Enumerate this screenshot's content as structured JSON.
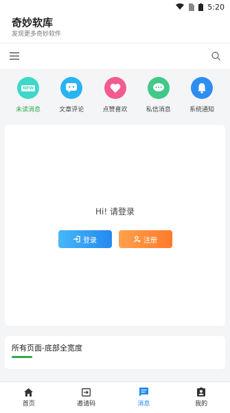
{
  "status": {
    "time": "5:20"
  },
  "app": {
    "title": "奇妙软库",
    "subtitle": "发现更多奇妙软件"
  },
  "shortcuts": [
    {
      "label": "未读消息",
      "badge": "NEW",
      "color": "#3dd8c8",
      "icon": "new-badge-icon"
    },
    {
      "label": "文章评论",
      "color": "#29b4f0",
      "icon": "chat-bubble-icon"
    },
    {
      "label": "点赞喜欢",
      "color": "#f25b8f",
      "icon": "heart-icon"
    },
    {
      "label": "私信消息",
      "color": "#40c987",
      "icon": "message-dots-icon"
    },
    {
      "label": "系统通知",
      "color": "#2d8ef0",
      "icon": "bell-icon"
    }
  ],
  "login": {
    "greeting": "Hi!  请登录",
    "login_label": "登录",
    "register_label": "注册"
  },
  "footer_note": {
    "text": "所有页面-底部全宽度"
  },
  "tabs": [
    {
      "label": "首页",
      "icon": "home-icon"
    },
    {
      "label": "邀请码",
      "icon": "invite-code-icon"
    },
    {
      "label": "消息",
      "icon": "message-icon",
      "active": true
    },
    {
      "label": "我的",
      "icon": "profile-icon"
    }
  ],
  "colors": {
    "accent_blue": "#2489ee",
    "accent_green": "#2ea84a",
    "accent_orange": "#ff7a2a"
  }
}
